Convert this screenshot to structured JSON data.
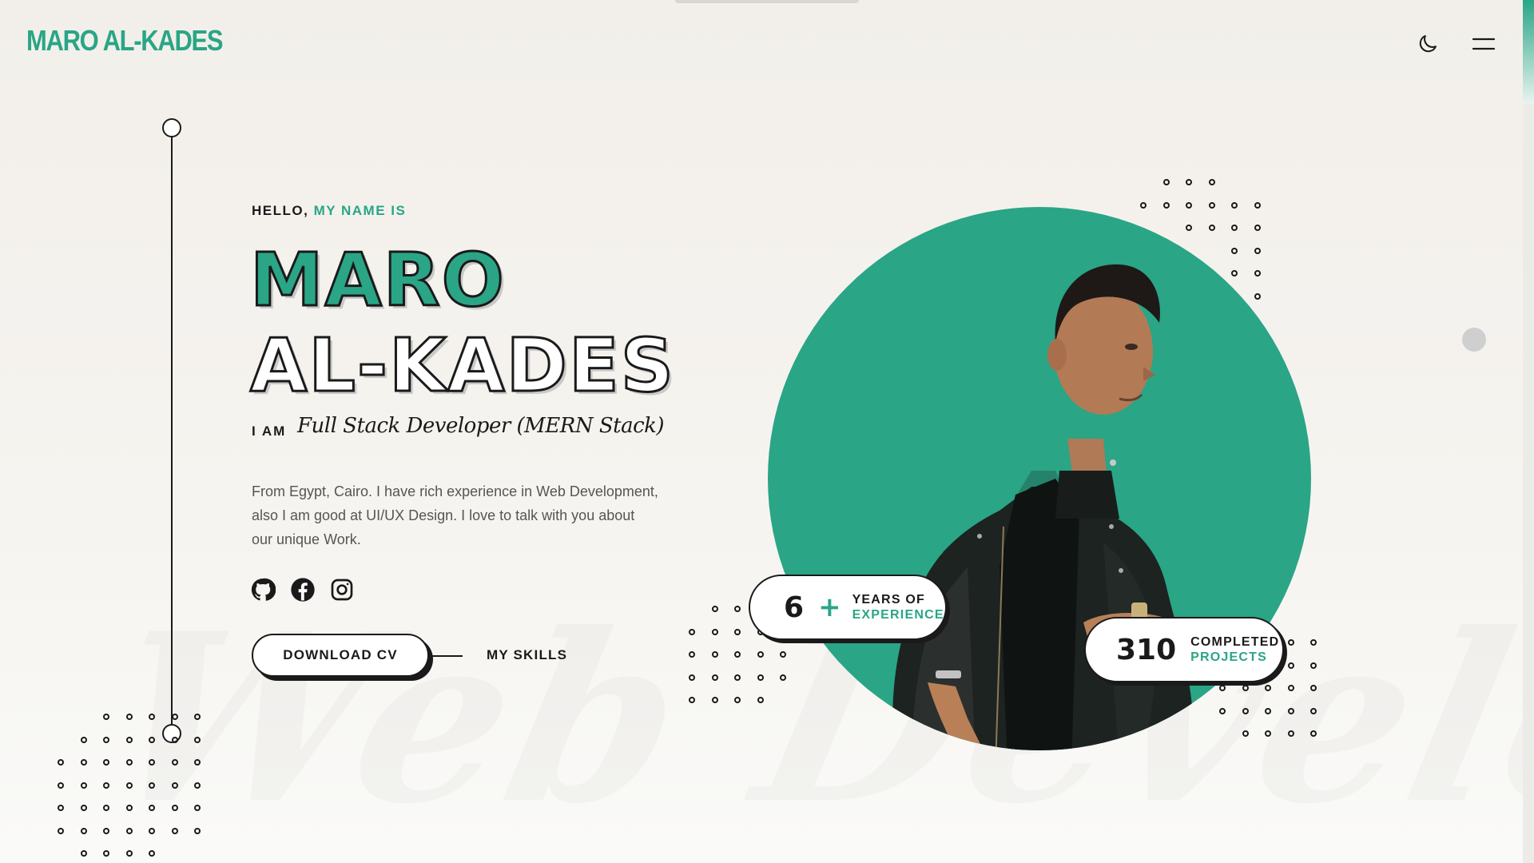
{
  "header": {
    "logo": "MARO AL-KADES",
    "theme_toggle_icon": "moon-icon",
    "menu_icon": "hamburger-menu-icon"
  },
  "hero": {
    "greeting_part1": "HELLO,",
    "greeting_part2": "MY NAME IS",
    "first_name": "MARO",
    "last_name": "AL-KADES",
    "iam_label": "I AM",
    "role": "Full Stack Developer (MERN Stack)",
    "description": "From Egypt, Cairo. I have rich experience in Web Development, also I am good at UI/UX Design. I love to talk with you about our unique Work.",
    "social": [
      {
        "name": "github-icon"
      },
      {
        "name": "facebook-icon"
      },
      {
        "name": "instagram-icon"
      }
    ],
    "download_cv": "DOWNLOAD CV",
    "my_skills": "MY SKILLS",
    "watermark": "Web Developer"
  },
  "stats": {
    "experience": {
      "value": "6",
      "plus": "+",
      "line1": "YEARS OF",
      "line2": "EXPERIENCE"
    },
    "projects": {
      "value": "310",
      "line1": "COMPLETED",
      "line2": "PROJECTS"
    }
  },
  "colors": {
    "accent": "#2aa586",
    "ink": "#1a1a1a",
    "background": "#f4f2ee"
  }
}
